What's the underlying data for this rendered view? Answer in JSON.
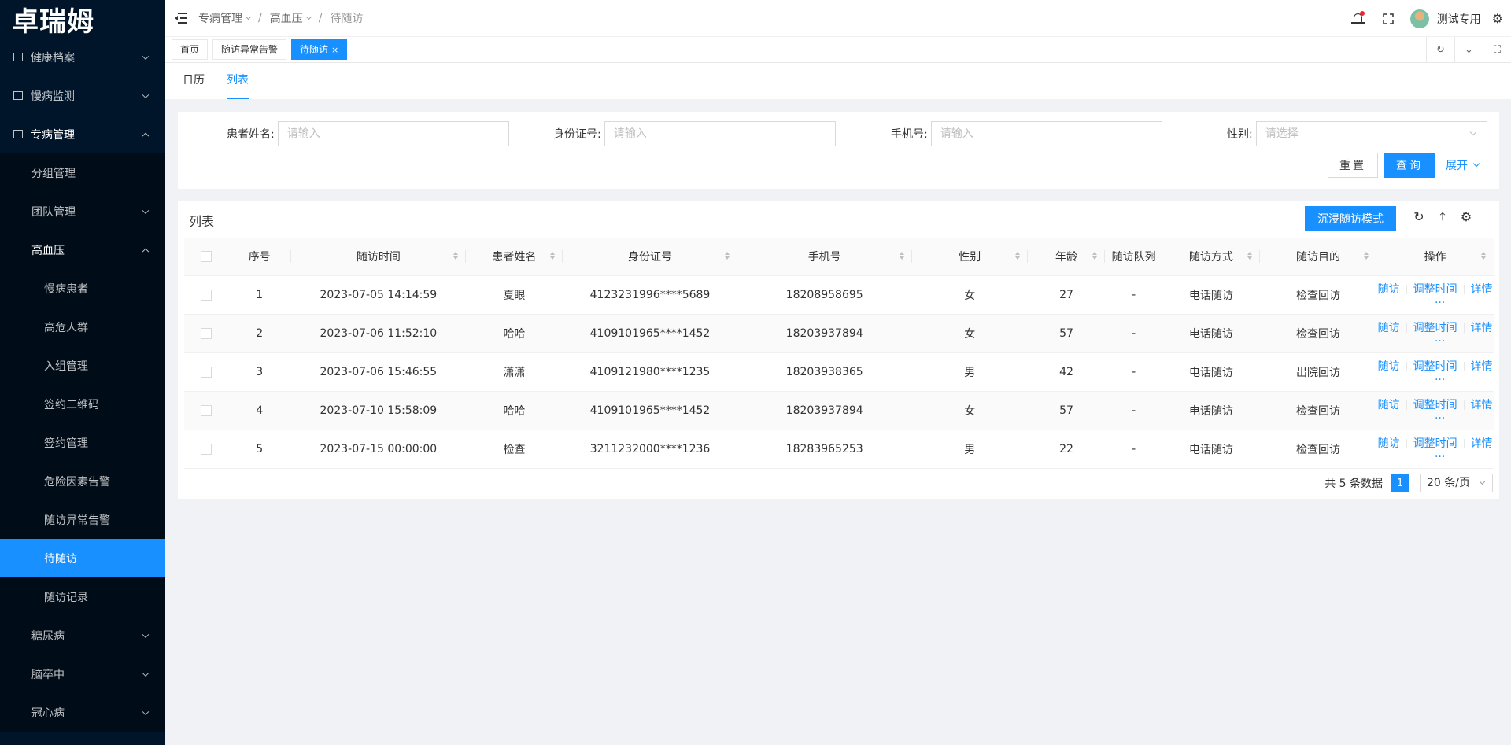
{
  "app": {
    "logo": "卓瑞姆"
  },
  "sidebar": {
    "items": [
      {
        "label": "健康档案",
        "icon": "archive-icon",
        "level": 1,
        "chevron": "down"
      },
      {
        "label": "慢病监测",
        "icon": "monitor-icon",
        "level": 1,
        "chevron": "down"
      },
      {
        "label": "专病管理",
        "icon": "disease-icon",
        "level": 1,
        "chevron": "up"
      },
      {
        "label": "分组管理",
        "level": 2
      },
      {
        "label": "团队管理",
        "level": 2,
        "chevron": "down"
      },
      {
        "label": "高血压",
        "level": 2,
        "chevron": "up"
      },
      {
        "label": "慢病患者",
        "level": 3
      },
      {
        "label": "高危人群",
        "level": 3
      },
      {
        "label": "入组管理",
        "level": 3
      },
      {
        "label": "签约二维码",
        "level": 3
      },
      {
        "label": "签约管理",
        "level": 3
      },
      {
        "label": "危险因素告警",
        "level": 3
      },
      {
        "label": "随访异常告警",
        "level": 3
      },
      {
        "label": "待随访",
        "level": 3,
        "active": true
      },
      {
        "label": "随访记录",
        "level": 3
      },
      {
        "label": "糖尿病",
        "level": 2,
        "chevron": "down"
      },
      {
        "label": "脑卒中",
        "level": 2,
        "chevron": "down"
      },
      {
        "label": "冠心病",
        "level": 2,
        "chevron": "down"
      }
    ]
  },
  "header": {
    "breadcrumb": [
      "专病管理",
      "高血压",
      "待随访"
    ],
    "username": "测试专用"
  },
  "tabs": [
    {
      "label": "首页"
    },
    {
      "label": "随访异常告警"
    },
    {
      "label": "待随访",
      "active": true,
      "close": "×"
    }
  ],
  "subtabs": [
    {
      "label": "日历"
    },
    {
      "label": "列表",
      "active": true
    }
  ],
  "search": {
    "name_label": "患者姓名:",
    "name_placeholder": "请输入",
    "id_label": "身份证号:",
    "id_placeholder": "请输入",
    "phone_label": "手机号:",
    "phone_placeholder": "请输入",
    "gender_label": "性别:",
    "gender_placeholder": "请选择",
    "reset": "重置",
    "query": "查询",
    "expand": "展开"
  },
  "list": {
    "title": "列表",
    "immersive_button": "沉浸随访模式",
    "columns": [
      "序号",
      "随访时间",
      "患者姓名",
      "身份证号",
      "手机号",
      "性别",
      "年龄",
      "随访队列",
      "随访方式",
      "随访目的",
      "操作"
    ],
    "rows": [
      {
        "no": "1",
        "time": "2023-07-05 14:14:59",
        "name": "夏眼",
        "id": "4123231996****5689",
        "phone": "18208958695",
        "gender": "女",
        "age": "27",
        "queue": "-",
        "method": "电话随访",
        "purpose": "检查回访"
      },
      {
        "no": "2",
        "time": "2023-07-06 11:52:10",
        "name": "哈哈",
        "id": "4109101965****1452",
        "phone": "18203937894",
        "gender": "女",
        "age": "57",
        "queue": "-",
        "method": "电话随访",
        "purpose": "检查回访"
      },
      {
        "no": "3",
        "time": "2023-07-06 15:46:55",
        "name": "潇潇",
        "id": "4109121980****1235",
        "phone": "18203938365",
        "gender": "男",
        "age": "42",
        "queue": "-",
        "method": "电话随访",
        "purpose": "出院回访"
      },
      {
        "no": "4",
        "time": "2023-07-10 15:58:09",
        "name": "哈哈",
        "id": "4109101965****1452",
        "phone": "18203937894",
        "gender": "女",
        "age": "57",
        "queue": "-",
        "method": "电话随访",
        "purpose": "检查回访"
      },
      {
        "no": "5",
        "time": "2023-07-15 00:00:00",
        "name": "检查",
        "id": "3211232000****1236",
        "phone": "18283965253",
        "gender": "男",
        "age": "22",
        "queue": "-",
        "method": "电话随访",
        "purpose": "检查回访"
      }
    ],
    "actions": {
      "visit": "随访",
      "adjust": "调整时间",
      "detail": "详情",
      "more": "···"
    }
  },
  "pagination": {
    "total": "共 5 条数据",
    "current": "1",
    "page_size": "20 条/页"
  },
  "colors": {
    "primary": "#1890ff",
    "sidebar_bg": "#001529"
  }
}
